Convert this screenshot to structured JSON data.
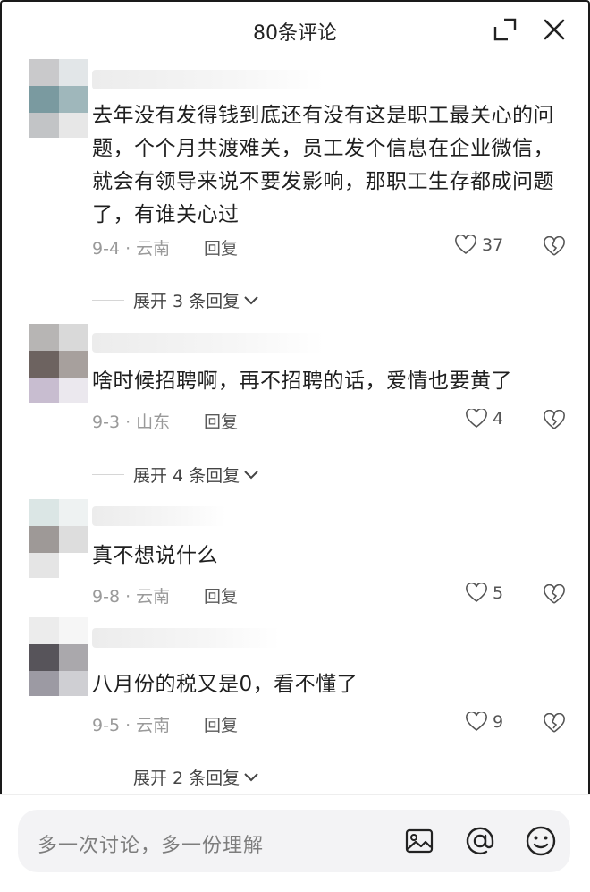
{
  "header": {
    "title": "80条评论"
  },
  "comments": [
    {
      "text": "去年没有发得钱到底还有没有这是职工最关心的问题，个个月共渡难关，员工发个信息在企业微信，就会有领导来说不要发影响，那职工生存都成问题了，有谁关心过",
      "date_location": "9-4 · 云南",
      "reply_label": "回复",
      "likes": "37",
      "expand_label": "展开 3 条回复"
    },
    {
      "text": "啥时候招聘啊，再不招聘的话，爱情也要黄了",
      "date_location": "9-3 · 山东",
      "reply_label": "回复",
      "likes": "4",
      "expand_label": "展开 4 条回复"
    },
    {
      "text": "真不想说什么",
      "date_location": "9-8 · 云南",
      "reply_label": "回复",
      "likes": "5"
    },
    {
      "text": "八月份的税又是0，看不懂了",
      "date_location": "9-5 · 云南",
      "reply_label": "回复",
      "likes": "9",
      "expand_label": "展开 2 条回复"
    }
  ],
  "composer": {
    "placeholder": "多一次讨论，多一份理解"
  },
  "icons": {
    "expand": "fullscreen-icon",
    "close": "close-icon",
    "like": "heart-outline-icon",
    "dislike": "broken-heart-icon",
    "image": "image-icon",
    "mention": "at-icon",
    "emoji": "emoji-icon"
  },
  "colors": {
    "text": "#1f1f1f",
    "meta": "#9a9a9a",
    "background": "#ffffff"
  }
}
